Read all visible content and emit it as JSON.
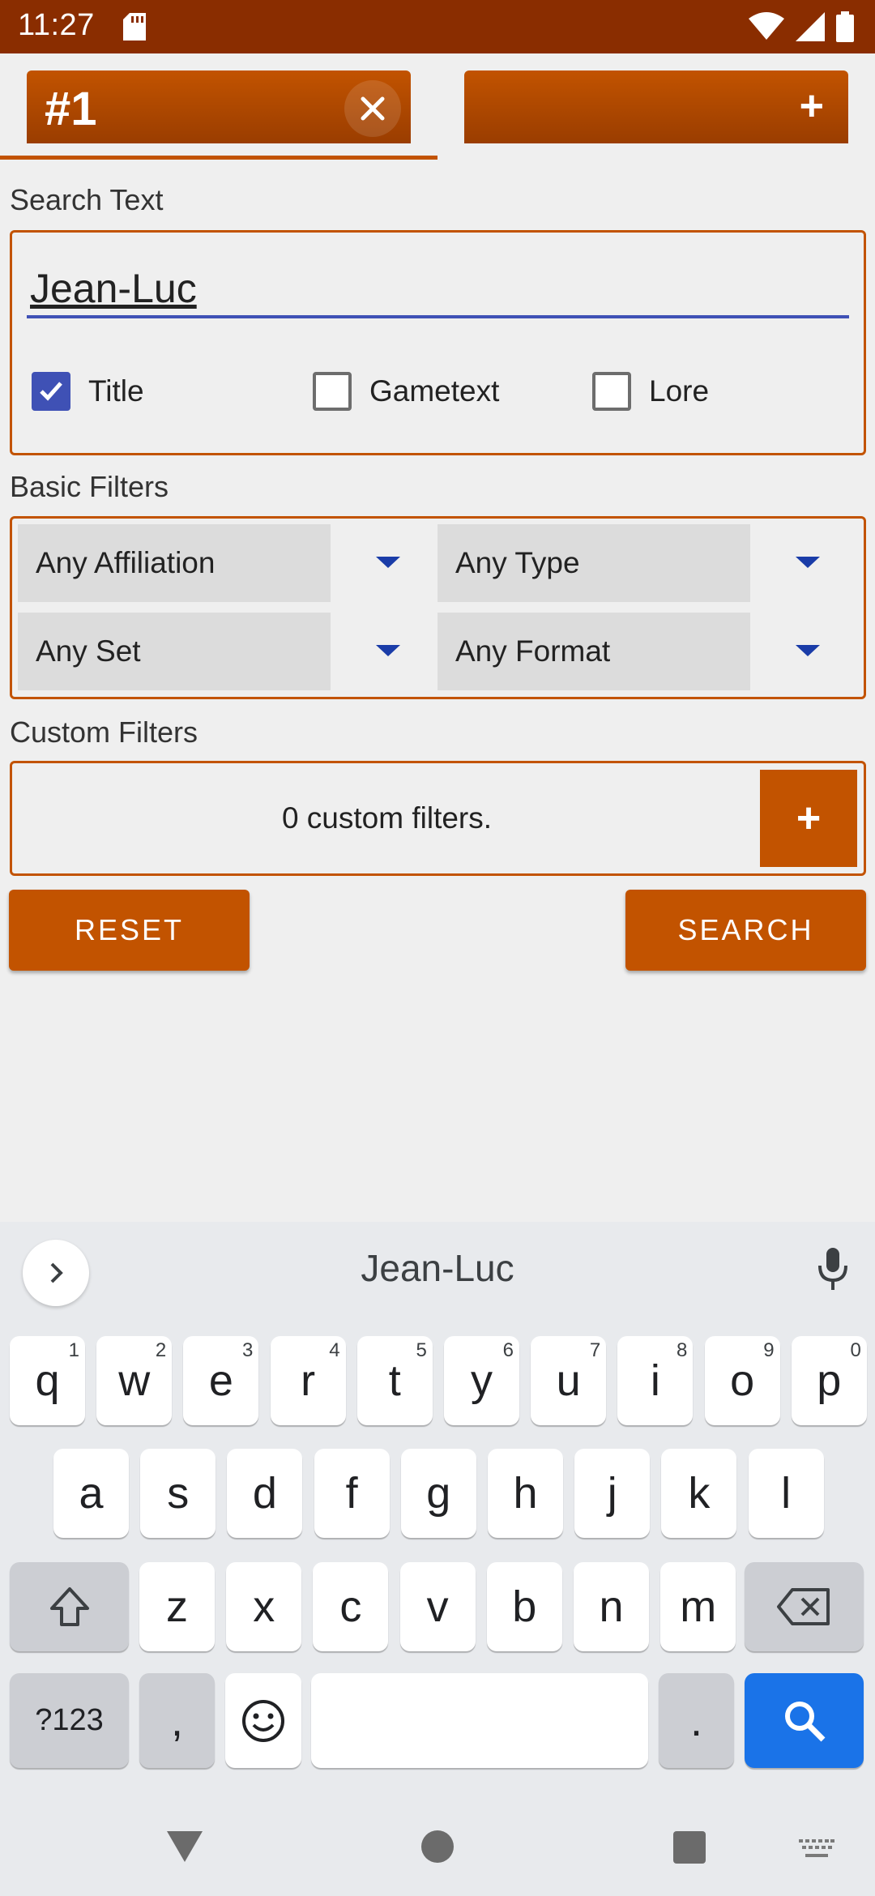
{
  "status": {
    "time": "11:27"
  },
  "tabs": [
    {
      "label": "#1"
    },
    {
      "label": "+"
    }
  ],
  "search": {
    "section_label": "Search Text",
    "value": "Jean-Luc",
    "options": [
      {
        "label": "Title",
        "checked": true
      },
      {
        "label": "Gametext",
        "checked": false
      },
      {
        "label": "Lore",
        "checked": false
      }
    ]
  },
  "basic_filters": {
    "section_label": "Basic Filters",
    "affiliation": "Any Affiliation",
    "type": "Any Type",
    "set": "Any Set",
    "format": "Any Format"
  },
  "custom_filters": {
    "section_label": "Custom Filters",
    "summary": "0 custom filters.",
    "add_label": "+"
  },
  "actions": {
    "reset": "RESET",
    "search": "SEARCH"
  },
  "keyboard": {
    "suggestion": "Jean-Luc",
    "row1": [
      {
        "k": "q",
        "h": "1"
      },
      {
        "k": "w",
        "h": "2"
      },
      {
        "k": "e",
        "h": "3"
      },
      {
        "k": "r",
        "h": "4"
      },
      {
        "k": "t",
        "h": "5"
      },
      {
        "k": "y",
        "h": "6"
      },
      {
        "k": "u",
        "h": "7"
      },
      {
        "k": "i",
        "h": "8"
      },
      {
        "k": "o",
        "h": "9"
      },
      {
        "k": "p",
        "h": "0"
      }
    ],
    "row2": [
      "a",
      "s",
      "d",
      "f",
      "g",
      "h",
      "j",
      "k",
      "l"
    ],
    "row3": [
      "z",
      "x",
      "c",
      "v",
      "b",
      "n",
      "m"
    ],
    "symbols": "?123",
    "comma": ",",
    "period": "."
  },
  "colors": {
    "accent": "#c25300",
    "statusbar": "#8a2d00",
    "checkbox": "#3f51b5"
  }
}
